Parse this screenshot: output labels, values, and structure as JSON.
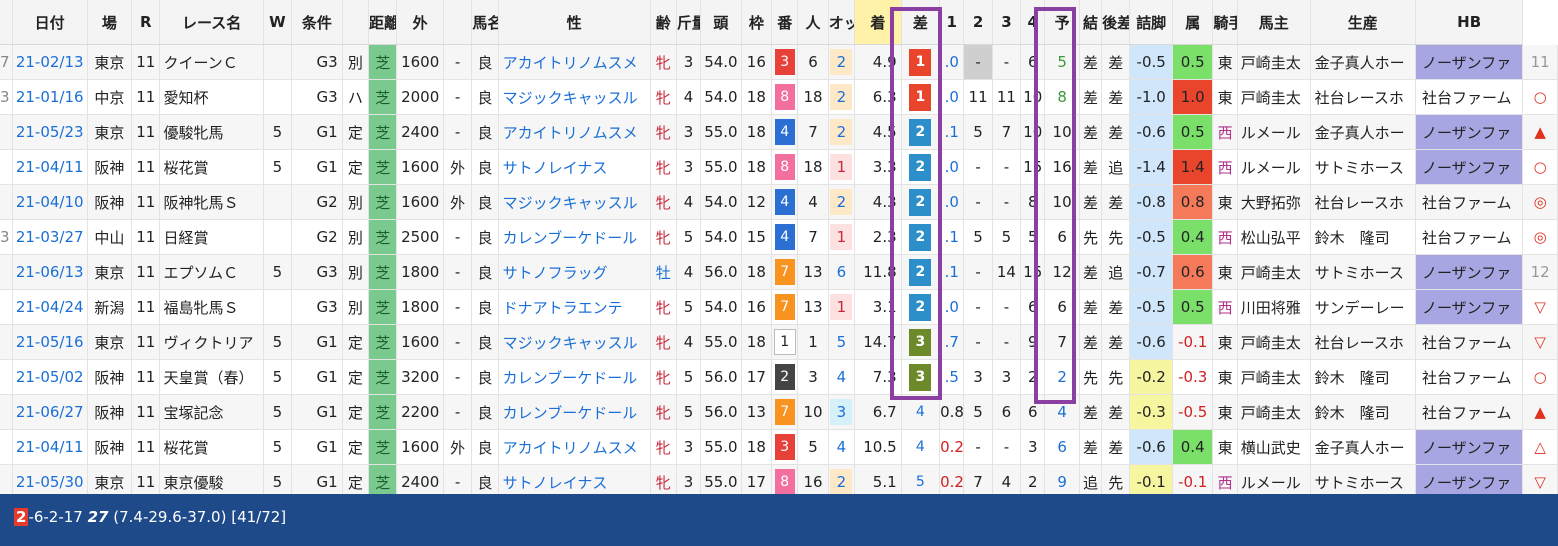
{
  "headers": [
    "日付",
    "場",
    "R",
    "レース名",
    "W",
    "条件",
    "",
    "距離",
    "外",
    "",
    "馬名",
    "性",
    "齢",
    "斤量",
    "頭",
    "枠",
    "番",
    "人",
    "オッズ",
    "着",
    "差",
    "1",
    "2",
    "3",
    "4",
    "予",
    "結",
    "後差",
    "詰脚",
    "属",
    "騎手",
    "馬主",
    "生産",
    "HB"
  ],
  "rows": [
    {
      "lead": "7",
      "date": "21-02/13",
      "place": "東京",
      "r": "11",
      "race": "クイーンＣ",
      "w": "",
      "grade": "G3",
      "cond": "別",
      "surface": "芝",
      "dist": "1600",
      "outer": "-",
      "track": "良",
      "horse": "アカイトリノムスメ",
      "sex": "牝",
      "age": "3",
      "weight": "54.0",
      "heads": "16",
      "waku": "3",
      "num": "6",
      "pop": "2",
      "odds": "4.9",
      "chaku": "1",
      "sa": ".0",
      "c1": "-",
      "c2": "-",
      "c3": "6",
      "c4": "5",
      "yo": "差",
      "ketsu": "差",
      "kosa": "-0.5",
      "tsume": "0.5",
      "zoku": "東",
      "jockey": "戸崎圭太",
      "owner": "金子真人ホー",
      "breeder": "ノーザンファ",
      "hb": "11"
    },
    {
      "lead": "3",
      "date": "21-01/16",
      "place": "中京",
      "r": "11",
      "race": "愛知杯",
      "w": "",
      "grade": "G3",
      "cond": "ハ",
      "surface": "芝",
      "dist": "2000",
      "outer": "-",
      "track": "良",
      "horse": "マジックキャッスル",
      "sex": "牝",
      "age": "4",
      "weight": "54.0",
      "heads": "18",
      "waku": "8",
      "num": "18",
      "pop": "2",
      "odds": "6.3",
      "chaku": "1",
      "sa": ".0",
      "c1": "11",
      "c2": "11",
      "c3": "10",
      "c4": "8",
      "yo": "差",
      "ketsu": "差",
      "kosa": "-1.0",
      "tsume": "1.0",
      "zoku": "東",
      "jockey": "戸崎圭太",
      "owner": "社台レースホ",
      "breeder": "社台ファーム",
      "hb": "○"
    },
    {
      "lead": "",
      "date": "21-05/23",
      "place": "東京",
      "r": "11",
      "race": "優駿牝馬",
      "w": "5",
      "grade": "G1",
      "cond": "定",
      "surface": "芝",
      "dist": "2400",
      "outer": "-",
      "track": "良",
      "horse": "アカイトリノムスメ",
      "sex": "牝",
      "age": "3",
      "weight": "55.0",
      "heads": "18",
      "waku": "4",
      "num": "7",
      "pop": "2",
      "odds": "4.5",
      "chaku": "2",
      "sa": ".1",
      "c1": "5",
      "c2": "7",
      "c3": "10",
      "c4": "10",
      "yo": "差",
      "ketsu": "差",
      "kosa": "-0.6",
      "tsume": "0.5",
      "zoku": "西",
      "jockey": "ルメール",
      "owner": "金子真人ホー",
      "breeder": "ノーザンファ",
      "hb": "▲"
    },
    {
      "lead": "",
      "date": "21-04/11",
      "place": "阪神",
      "r": "11",
      "race": "桜花賞",
      "w": "5",
      "grade": "G1",
      "cond": "定",
      "surface": "芝",
      "dist": "1600",
      "outer": "外",
      "track": "良",
      "horse": "サトノレイナス",
      "sex": "牝",
      "age": "3",
      "weight": "55.0",
      "heads": "18",
      "waku": "8",
      "num": "18",
      "pop": "1",
      "odds": "3.3",
      "chaku": "2",
      "sa": ".0",
      "c1": "-",
      "c2": "-",
      "c3": "15",
      "c4": "16",
      "yo": "差",
      "ketsu": "追",
      "kosa": "-1.4",
      "tsume": "1.4",
      "zoku": "西",
      "jockey": "ルメール",
      "owner": "サトミホース",
      "breeder": "ノーザンファ",
      "hb": "○"
    },
    {
      "lead": "",
      "date": "21-04/10",
      "place": "阪神",
      "r": "11",
      "race": "阪神牝馬Ｓ",
      "w": "",
      "grade": "G2",
      "cond": "別",
      "surface": "芝",
      "dist": "1600",
      "outer": "外",
      "track": "良",
      "horse": "マジックキャッスル",
      "sex": "牝",
      "age": "4",
      "weight": "54.0",
      "heads": "12",
      "waku": "4",
      "num": "4",
      "pop": "2",
      "odds": "4.3",
      "chaku": "2",
      "sa": ".0",
      "c1": "-",
      "c2": "-",
      "c3": "8",
      "c4": "10",
      "yo": "差",
      "ketsu": "差",
      "kosa": "-0.8",
      "tsume": "0.8",
      "zoku": "東",
      "jockey": "大野拓弥",
      "owner": "社台レースホ",
      "breeder": "社台ファーム",
      "hb": "◎"
    },
    {
      "lead": "3",
      "date": "21-03/27",
      "place": "中山",
      "r": "11",
      "race": "日経賞",
      "w": "",
      "grade": "G2",
      "cond": "別",
      "surface": "芝",
      "dist": "2500",
      "outer": "-",
      "track": "良",
      "horse": "カレンブーケドール",
      "sex": "牝",
      "age": "5",
      "weight": "54.0",
      "heads": "15",
      "waku": "4",
      "num": "7",
      "pop": "1",
      "odds": "2.3",
      "chaku": "2",
      "sa": ".1",
      "c1": "5",
      "c2": "5",
      "c3": "5",
      "c4": "6",
      "yo": "先",
      "ketsu": "先",
      "kosa": "-0.5",
      "tsume": "0.4",
      "zoku": "西",
      "jockey": "松山弘平",
      "owner": "鈴木　隆司",
      "breeder": "社台ファーム",
      "hb": "◎"
    },
    {
      "lead": "",
      "date": "21-06/13",
      "place": "東京",
      "r": "11",
      "race": "エプソムＣ",
      "w": "5",
      "grade": "G3",
      "cond": "別",
      "surface": "芝",
      "dist": "1800",
      "outer": "-",
      "track": "良",
      "horse": "サトノフラッグ",
      "sex": "牡",
      "age": "4",
      "weight": "56.0",
      "heads": "18",
      "waku": "7",
      "num": "13",
      "pop": "6",
      "odds": "11.8",
      "chaku": "2",
      "sa": ".1",
      "c1": "-",
      "c2": "14",
      "c3": "15",
      "c4": "12",
      "yo": "差",
      "ketsu": "追",
      "kosa": "-0.7",
      "tsume": "0.6",
      "zoku": "東",
      "jockey": "戸崎圭太",
      "owner": "サトミホース",
      "breeder": "ノーザンファ",
      "hb": "12"
    },
    {
      "lead": "",
      "date": "21-04/24",
      "place": "新潟",
      "r": "11",
      "race": "福島牝馬Ｓ",
      "w": "",
      "grade": "G3",
      "cond": "別",
      "surface": "芝",
      "dist": "1800",
      "outer": "-",
      "track": "良",
      "horse": "ドナアトラエンテ",
      "sex": "牝",
      "age": "5",
      "weight": "54.0",
      "heads": "16",
      "waku": "7",
      "num": "13",
      "pop": "1",
      "odds": "3.1",
      "chaku": "2",
      "sa": ".0",
      "c1": "-",
      "c2": "-",
      "c3": "6",
      "c4": "6",
      "yo": "差",
      "ketsu": "差",
      "kosa": "-0.5",
      "tsume": "0.5",
      "zoku": "西",
      "jockey": "川田将雅",
      "owner": "サンデーレー",
      "breeder": "ノーザンファ",
      "hb": "▽"
    },
    {
      "lead": "",
      "date": "21-05/16",
      "place": "東京",
      "r": "11",
      "race": "ヴィクトリア",
      "w": "5",
      "grade": "G1",
      "cond": "定",
      "surface": "芝",
      "dist": "1600",
      "outer": "-",
      "track": "良",
      "horse": "マジックキャッスル",
      "sex": "牝",
      "age": "4",
      "weight": "55.0",
      "heads": "18",
      "waku": "1",
      "num": "1",
      "pop": "5",
      "odds": "14.7",
      "chaku": "3",
      "sa": ".7",
      "c1": "-",
      "c2": "-",
      "c3": "9",
      "c4": "7",
      "yo": "差",
      "ketsu": "差",
      "kosa": "-0.6",
      "tsume": "-0.1",
      "zoku": "東",
      "jockey": "戸崎圭太",
      "owner": "社台レースホ",
      "breeder": "社台ファーム",
      "hb": "▽"
    },
    {
      "lead": "",
      "date": "21-05/02",
      "place": "阪神",
      "r": "11",
      "race": "天皇賞（春）",
      "w": "5",
      "grade": "G1",
      "cond": "定",
      "surface": "芝",
      "dist": "3200",
      "outer": "-",
      "track": "良",
      "horse": "カレンブーケドール",
      "sex": "牝",
      "age": "5",
      "weight": "56.0",
      "heads": "17",
      "waku": "2",
      "num": "3",
      "pop": "4",
      "odds": "7.3",
      "chaku": "3",
      "sa": ".5",
      "c1": "3",
      "c2": "3",
      "c3": "2",
      "c4": "2",
      "yo": "先",
      "ketsu": "先",
      "kosa": "-0.2",
      "tsume": "-0.3",
      "zoku": "東",
      "jockey": "戸崎圭太",
      "owner": "鈴木　隆司",
      "breeder": "社台ファーム",
      "hb": "○"
    },
    {
      "lead": "",
      "date": "21-06/27",
      "place": "阪神",
      "r": "11",
      "race": "宝塚記念",
      "w": "5",
      "grade": "G1",
      "cond": "定",
      "surface": "芝",
      "dist": "2200",
      "outer": "-",
      "track": "良",
      "horse": "カレンブーケドール",
      "sex": "牝",
      "age": "5",
      "weight": "56.0",
      "heads": "13",
      "waku": "7",
      "num": "10",
      "pop": "3",
      "odds": "6.7",
      "chaku": "4",
      "sa": "0.8",
      "c1": "5",
      "c2": "6",
      "c3": "6",
      "c4": "4",
      "yo": "差",
      "ketsu": "差",
      "kosa": "-0.3",
      "tsume": "-0.5",
      "zoku": "東",
      "jockey": "戸崎圭太",
      "owner": "鈴木　隆司",
      "breeder": "社台ファーム",
      "hb": "▲"
    },
    {
      "lead": "",
      "date": "21-04/11",
      "place": "阪神",
      "r": "11",
      "race": "桜花賞",
      "w": "5",
      "grade": "G1",
      "cond": "定",
      "surface": "芝",
      "dist": "1600",
      "outer": "外",
      "track": "良",
      "horse": "アカイトリノムスメ",
      "sex": "牝",
      "age": "3",
      "weight": "55.0",
      "heads": "18",
      "waku": "3",
      "num": "5",
      "pop": "4",
      "odds": "10.5",
      "chaku": "4",
      "sa": "0.2",
      "c1": "-",
      "c2": "-",
      "c3": "3",
      "c4": "6",
      "yo": "差",
      "ketsu": "差",
      "kosa": "-0.6",
      "tsume": "0.4",
      "zoku": "東",
      "jockey": "横山武史",
      "owner": "金子真人ホー",
      "breeder": "ノーザンファ",
      "hb": "△"
    },
    {
      "lead": "",
      "date": "21-05/30",
      "place": "東京",
      "r": "11",
      "race": "東京優駿",
      "w": "5",
      "grade": "G1",
      "cond": "定",
      "surface": "芝",
      "dist": "2400",
      "outer": "-",
      "track": "良",
      "horse": "サトノレイナス",
      "sex": "牝",
      "age": "3",
      "weight": "55.0",
      "heads": "17",
      "waku": "8",
      "num": "16",
      "pop": "2",
      "odds": "5.1",
      "chaku": "5",
      "sa": "0.2",
      "c1": "7",
      "c2": "4",
      "c3": "2",
      "c4": "9",
      "yo": "追",
      "ketsu": "先",
      "kosa": "-0.1",
      "tsume": "-0.1",
      "zoku": "西",
      "jockey": "ルメール",
      "owner": "サトミホース",
      "breeder": "ノーザンファ",
      "hb": "▽"
    }
  ],
  "footer": {
    "first": "2",
    "rest": "-6-2-17 ",
    "bold": "27",
    "tail": " (7.4-29.6-37.0) [41/72]"
  },
  "colors": {
    "accent_frame": "#8b3fa3",
    "footer_bg": "#1e4a8a"
  }
}
